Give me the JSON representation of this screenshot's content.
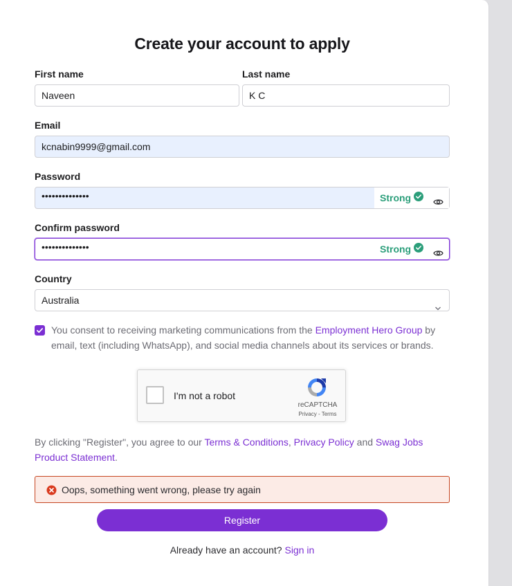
{
  "form": {
    "title": "Create your account to apply",
    "first_name": {
      "label": "First name",
      "value": "Naveen"
    },
    "last_name": {
      "label": "Last name",
      "value": "K C"
    },
    "email": {
      "label": "Email",
      "value": "kcnabin9999@gmail.com"
    },
    "password": {
      "label": "Password",
      "masked": "••••••••••••••",
      "strength": "Strong"
    },
    "confirm_password": {
      "label": "Confirm password",
      "masked": "••••••••••••••",
      "strength": "Strong"
    },
    "country": {
      "label": "Country",
      "value": "Australia"
    },
    "consent": {
      "checked": true,
      "text_before": "You consent to receiving marketing communications from the ",
      "link": "Employment Hero Group",
      "text_after": " by email, text (including WhatsApp), and social media channels about its services or brands."
    },
    "captcha": {
      "label": "I'm not a robot",
      "brand": "reCAPTCHA",
      "privacy": "Privacy",
      "separator": " - ",
      "terms": "Terms"
    },
    "terms": {
      "prefix": "By clicking \"Register\", you agree to our ",
      "terms_link": "Terms & Conditions",
      "comma": ", ",
      "privacy_link": "Privacy Policy",
      "and": " and ",
      "statement_link": "Swag Jobs Product Statement",
      "period": "."
    },
    "error": "Oops, something went wrong, please try again",
    "register_label": "Register",
    "signin_prompt": "Already have an account? ",
    "signin_link": "Sign in"
  },
  "colors": {
    "accent": "#7b2fd3",
    "strong": "#2b9e7a",
    "error_border": "#c5441f",
    "error_bg": "#fcebe6",
    "error_icon": "#d93a1f"
  },
  "icons": {
    "strength_check": "check-circle-icon",
    "show_password": "eye-icon",
    "select": "chevron-down-icon",
    "error": "error-circle-icon",
    "captcha": "recaptcha-logo-icon"
  }
}
